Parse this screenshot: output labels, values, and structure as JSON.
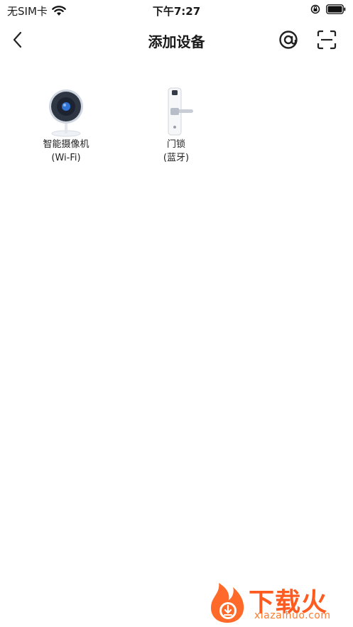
{
  "status_bar": {
    "carrier": "无SIM卡",
    "time": "下午7:27"
  },
  "nav": {
    "title": "添加设备"
  },
  "devices": [
    {
      "name": "智能摄像机",
      "sub": "(Wi-Fi)",
      "icon": "camera-icon"
    },
    {
      "name": "门锁",
      "sub": "(蓝牙)",
      "icon": "door-lock-icon"
    }
  ],
  "watermark": {
    "title": "下载火",
    "url": "xiazaihuo.com"
  },
  "colors": {
    "accent": "#ff5a1f",
    "text": "#1a1a1a"
  }
}
